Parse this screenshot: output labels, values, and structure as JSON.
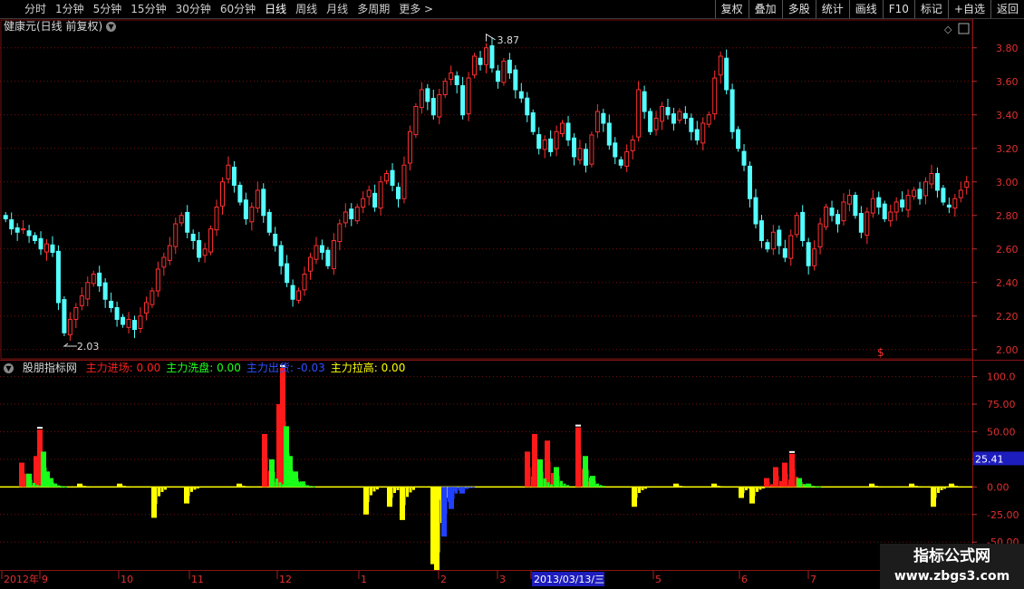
{
  "toolbar": {
    "timeframes": [
      "分时",
      "1分钟",
      "5分钟",
      "15分钟",
      "30分钟",
      "60分钟",
      "日线",
      "周线",
      "月线",
      "多周期",
      "更多"
    ],
    "active_timeframe": "日线",
    "right_buttons": [
      "复权",
      "叠加",
      "多股",
      "统计",
      "画线",
      "F10",
      "标记",
      "+自选",
      "返回"
    ]
  },
  "main_chart": {
    "stock_label": "健康元(日线 前复权)",
    "price_ticks": [
      "3.80",
      "3.60",
      "3.40",
      "3.20",
      "3.00",
      "2.80",
      "2.60",
      "2.40",
      "2.20",
      "2.00"
    ],
    "high_label": "3.87",
    "low_label": "2.03",
    "marker_label": "$"
  },
  "indicator": {
    "name": "股朋指标网",
    "series_labels": [
      {
        "label": "主力进场: 0.00",
        "color": "#ff2020"
      },
      {
        "label": "主力洗盘: 0.00",
        "color": "#20ff20"
      },
      {
        "label": "主力出货: -0.03",
        "color": "#3050ff"
      },
      {
        "label": "主力拉高: 0.00",
        "color": "#ffff00"
      }
    ],
    "ticks": [
      "100.0",
      "75.00",
      "50.00",
      "25.00",
      "0.00",
      "-25.00",
      "-50.00"
    ],
    "current_value": "25.41"
  },
  "date_axis": {
    "labels": [
      "2012年",
      "9",
      "10",
      "11",
      "12",
      "1",
      "2",
      "3",
      "2013/03/13/三",
      "5",
      "6",
      "7"
    ]
  },
  "watermark": {
    "line1": "指标公式网",
    "line2": "www.zbgs3.com"
  },
  "colors": {
    "up": "#ff3030",
    "down": "#54ffff",
    "grid": "#7a1010",
    "cursor_label_bg": "#1d1dbd"
  },
  "chart_data": {
    "type": "candlestick",
    "price_ylim": [
      1.95,
      3.95
    ],
    "price_series_close": [
      2.78,
      2.72,
      2.7,
      2.72,
      2.68,
      2.65,
      2.6,
      2.63,
      2.58,
      2.28,
      2.1,
      2.18,
      2.25,
      2.32,
      2.4,
      2.45,
      2.38,
      2.3,
      2.25,
      2.18,
      2.15,
      2.18,
      2.12,
      2.2,
      2.28,
      2.35,
      2.48,
      2.55,
      2.62,
      2.75,
      2.8,
      2.7,
      2.65,
      2.55,
      2.6,
      2.72,
      2.85,
      3.0,
      3.1,
      2.98,
      2.88,
      2.78,
      2.85,
      2.95,
      2.8,
      2.7,
      2.62,
      2.5,
      2.4,
      2.3,
      2.35,
      2.45,
      2.55,
      2.62,
      2.58,
      2.5,
      2.65,
      2.75,
      2.82,
      2.78,
      2.85,
      2.9,
      2.95,
      2.85,
      3.0,
      3.05,
      2.98,
      2.9,
      3.1,
      3.3,
      3.45,
      3.55,
      3.48,
      3.4,
      3.52,
      3.6,
      3.65,
      3.58,
      3.4,
      3.62,
      3.75,
      3.7,
      3.8,
      3.68,
      3.6,
      3.72,
      3.65,
      3.55,
      3.5,
      3.4,
      3.3,
      3.2,
      3.25,
      3.18,
      3.3,
      3.35,
      3.25,
      3.15,
      3.2,
      3.1,
      3.28,
      3.42,
      3.35,
      3.22,
      3.15,
      3.1,
      3.18,
      3.25,
      3.55,
      3.42,
      3.3,
      3.38,
      3.45,
      3.4,
      3.35,
      3.42,
      3.38,
      3.3,
      3.25,
      3.35,
      3.4,
      3.62,
      3.75,
      3.55,
      3.3,
      3.2,
      3.1,
      2.9,
      2.75,
      2.65,
      2.6,
      2.7,
      2.62,
      2.55,
      2.68,
      2.8,
      2.65,
      2.5,
      2.6,
      2.75,
      2.85,
      2.8,
      2.75,
      2.88,
      2.92,
      2.8,
      2.7,
      2.82,
      2.9,
      2.85,
      2.78,
      2.82,
      2.88,
      2.85,
      2.92,
      2.95,
      2.9,
      3.0,
      3.05,
      2.95,
      2.88,
      2.85,
      2.9,
      2.95,
      3.0
    ],
    "indicator_ylim": [
      -72,
      112
    ],
    "indicator_bars": [
      {
        "series": "主力进场",
        "x": [
          24,
          28,
          40,
          44
        ],
        "values": [
          22,
          12,
          28,
          52
        ]
      },
      {
        "series": "主力洗盘",
        "x": [
          32,
          48,
          52,
          56,
          60
        ],
        "values": [
          12,
          32,
          14,
          8,
          3
        ]
      },
      {
        "series": "主力拉高",
        "x": [
          88,
          132,
          170,
          206,
          264
        ],
        "values": [
          3,
          3,
          -28,
          -15,
          3
        ]
      },
      {
        "series": "主力进场",
        "x": [
          292,
          308,
          312
        ],
        "values": [
          48,
          75,
          108
        ]
      },
      {
        "series": "主力洗盘",
        "x": [
          300,
          316,
          320,
          326,
          334
        ],
        "values": [
          25,
          55,
          28,
          14,
          5
        ]
      },
      {
        "series": "主力拉高",
        "x": [
          404,
          430,
          444,
          478,
          482
        ],
        "values": [
          -25,
          -18,
          -30,
          -70,
          -108
        ]
      },
      {
        "series": "主力出货",
        "x": [
          490,
          498,
          510
        ],
        "values": [
          -45,
          -20,
          -6
        ]
      },
      {
        "series": "主力进场",
        "x": [
          582,
          590,
          604,
          638
        ],
        "values": [
          32,
          48,
          42,
          54
        ]
      },
      {
        "series": "主力洗盘",
        "x": [
          596,
          614,
          646,
          654
        ],
        "values": [
          25,
          18,
          28,
          10
        ]
      },
      {
        "series": "主力拉高",
        "x": [
          700,
          746,
          788,
          818,
          830
        ],
        "values": [
          -18,
          3,
          3,
          -10,
          -15
        ]
      },
      {
        "series": "主力进场",
        "x": [
          846,
          856,
          866,
          874
        ],
        "values": [
          8,
          18,
          22,
          30
        ]
      },
      {
        "series": "主力洗盘",
        "x": [
          882,
          892
        ],
        "values": [
          8,
          3
        ]
      },
      {
        "series": "主力拉高",
        "x": [
          962,
          1006,
          1030,
          1050
        ],
        "values": [
          3,
          3,
          -18,
          3
        ]
      }
    ]
  }
}
